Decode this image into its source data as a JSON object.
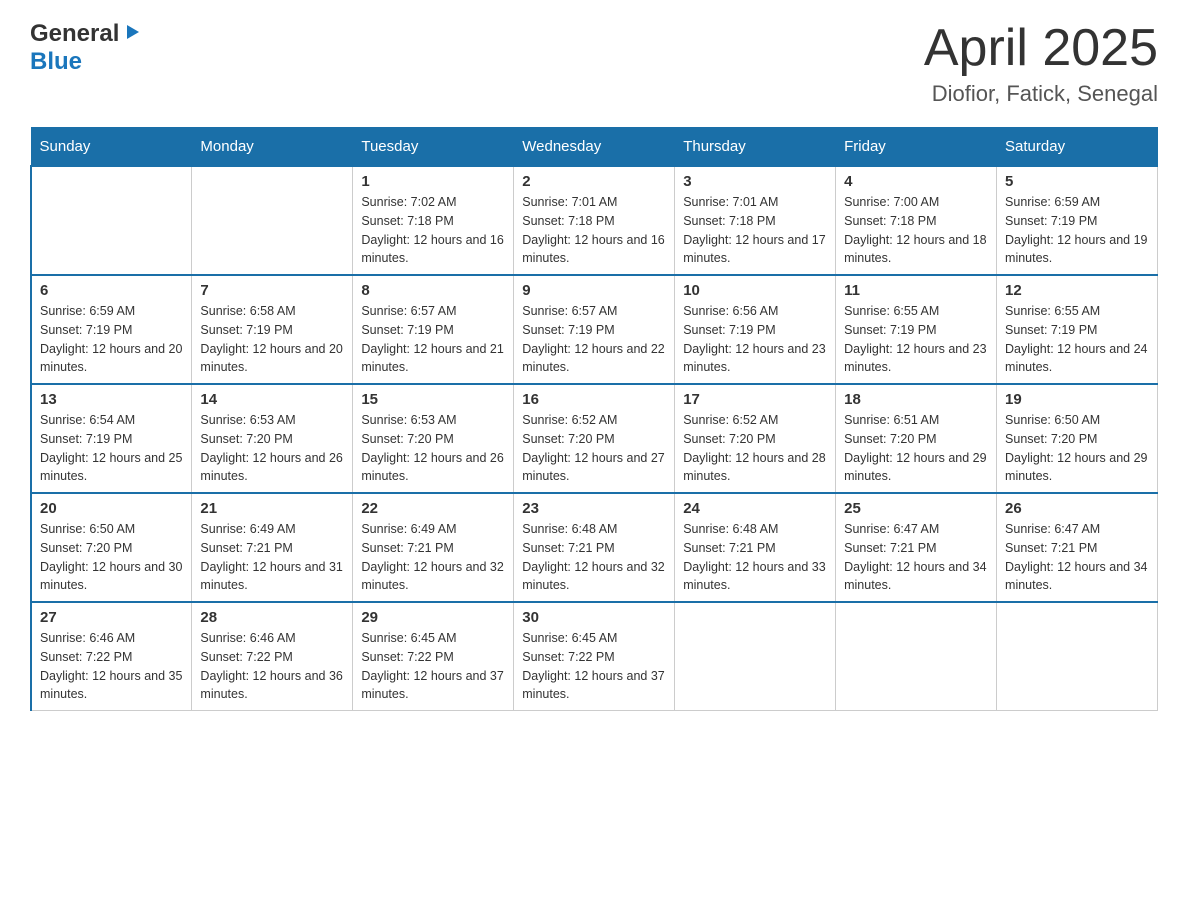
{
  "header": {
    "logo_general": "General",
    "logo_blue": "Blue",
    "month_title": "April 2025",
    "location": "Diofior, Fatick, Senegal"
  },
  "weekdays": [
    "Sunday",
    "Monday",
    "Tuesday",
    "Wednesday",
    "Thursday",
    "Friday",
    "Saturday"
  ],
  "weeks": [
    [
      {
        "day": "",
        "sunrise": "",
        "sunset": "",
        "daylight": ""
      },
      {
        "day": "",
        "sunrise": "",
        "sunset": "",
        "daylight": ""
      },
      {
        "day": "1",
        "sunrise": "Sunrise: 7:02 AM",
        "sunset": "Sunset: 7:18 PM",
        "daylight": "Daylight: 12 hours and 16 minutes."
      },
      {
        "day": "2",
        "sunrise": "Sunrise: 7:01 AM",
        "sunset": "Sunset: 7:18 PM",
        "daylight": "Daylight: 12 hours and 16 minutes."
      },
      {
        "day": "3",
        "sunrise": "Sunrise: 7:01 AM",
        "sunset": "Sunset: 7:18 PM",
        "daylight": "Daylight: 12 hours and 17 minutes."
      },
      {
        "day": "4",
        "sunrise": "Sunrise: 7:00 AM",
        "sunset": "Sunset: 7:18 PM",
        "daylight": "Daylight: 12 hours and 18 minutes."
      },
      {
        "day": "5",
        "sunrise": "Sunrise: 6:59 AM",
        "sunset": "Sunset: 7:19 PM",
        "daylight": "Daylight: 12 hours and 19 minutes."
      }
    ],
    [
      {
        "day": "6",
        "sunrise": "Sunrise: 6:59 AM",
        "sunset": "Sunset: 7:19 PM",
        "daylight": "Daylight: 12 hours and 20 minutes."
      },
      {
        "day": "7",
        "sunrise": "Sunrise: 6:58 AM",
        "sunset": "Sunset: 7:19 PM",
        "daylight": "Daylight: 12 hours and 20 minutes."
      },
      {
        "day": "8",
        "sunrise": "Sunrise: 6:57 AM",
        "sunset": "Sunset: 7:19 PM",
        "daylight": "Daylight: 12 hours and 21 minutes."
      },
      {
        "day": "9",
        "sunrise": "Sunrise: 6:57 AM",
        "sunset": "Sunset: 7:19 PM",
        "daylight": "Daylight: 12 hours and 22 minutes."
      },
      {
        "day": "10",
        "sunrise": "Sunrise: 6:56 AM",
        "sunset": "Sunset: 7:19 PM",
        "daylight": "Daylight: 12 hours and 23 minutes."
      },
      {
        "day": "11",
        "sunrise": "Sunrise: 6:55 AM",
        "sunset": "Sunset: 7:19 PM",
        "daylight": "Daylight: 12 hours and 23 minutes."
      },
      {
        "day": "12",
        "sunrise": "Sunrise: 6:55 AM",
        "sunset": "Sunset: 7:19 PM",
        "daylight": "Daylight: 12 hours and 24 minutes."
      }
    ],
    [
      {
        "day": "13",
        "sunrise": "Sunrise: 6:54 AM",
        "sunset": "Sunset: 7:19 PM",
        "daylight": "Daylight: 12 hours and 25 minutes."
      },
      {
        "day": "14",
        "sunrise": "Sunrise: 6:53 AM",
        "sunset": "Sunset: 7:20 PM",
        "daylight": "Daylight: 12 hours and 26 minutes."
      },
      {
        "day": "15",
        "sunrise": "Sunrise: 6:53 AM",
        "sunset": "Sunset: 7:20 PM",
        "daylight": "Daylight: 12 hours and 26 minutes."
      },
      {
        "day": "16",
        "sunrise": "Sunrise: 6:52 AM",
        "sunset": "Sunset: 7:20 PM",
        "daylight": "Daylight: 12 hours and 27 minutes."
      },
      {
        "day": "17",
        "sunrise": "Sunrise: 6:52 AM",
        "sunset": "Sunset: 7:20 PM",
        "daylight": "Daylight: 12 hours and 28 minutes."
      },
      {
        "day": "18",
        "sunrise": "Sunrise: 6:51 AM",
        "sunset": "Sunset: 7:20 PM",
        "daylight": "Daylight: 12 hours and 29 minutes."
      },
      {
        "day": "19",
        "sunrise": "Sunrise: 6:50 AM",
        "sunset": "Sunset: 7:20 PM",
        "daylight": "Daylight: 12 hours and 29 minutes."
      }
    ],
    [
      {
        "day": "20",
        "sunrise": "Sunrise: 6:50 AM",
        "sunset": "Sunset: 7:20 PM",
        "daylight": "Daylight: 12 hours and 30 minutes."
      },
      {
        "day": "21",
        "sunrise": "Sunrise: 6:49 AM",
        "sunset": "Sunset: 7:21 PM",
        "daylight": "Daylight: 12 hours and 31 minutes."
      },
      {
        "day": "22",
        "sunrise": "Sunrise: 6:49 AM",
        "sunset": "Sunset: 7:21 PM",
        "daylight": "Daylight: 12 hours and 32 minutes."
      },
      {
        "day": "23",
        "sunrise": "Sunrise: 6:48 AM",
        "sunset": "Sunset: 7:21 PM",
        "daylight": "Daylight: 12 hours and 32 minutes."
      },
      {
        "day": "24",
        "sunrise": "Sunrise: 6:48 AM",
        "sunset": "Sunset: 7:21 PM",
        "daylight": "Daylight: 12 hours and 33 minutes."
      },
      {
        "day": "25",
        "sunrise": "Sunrise: 6:47 AM",
        "sunset": "Sunset: 7:21 PM",
        "daylight": "Daylight: 12 hours and 34 minutes."
      },
      {
        "day": "26",
        "sunrise": "Sunrise: 6:47 AM",
        "sunset": "Sunset: 7:21 PM",
        "daylight": "Daylight: 12 hours and 34 minutes."
      }
    ],
    [
      {
        "day": "27",
        "sunrise": "Sunrise: 6:46 AM",
        "sunset": "Sunset: 7:22 PM",
        "daylight": "Daylight: 12 hours and 35 minutes."
      },
      {
        "day": "28",
        "sunrise": "Sunrise: 6:46 AM",
        "sunset": "Sunset: 7:22 PM",
        "daylight": "Daylight: 12 hours and 36 minutes."
      },
      {
        "day": "29",
        "sunrise": "Sunrise: 6:45 AM",
        "sunset": "Sunset: 7:22 PM",
        "daylight": "Daylight: 12 hours and 37 minutes."
      },
      {
        "day": "30",
        "sunrise": "Sunrise: 6:45 AM",
        "sunset": "Sunset: 7:22 PM",
        "daylight": "Daylight: 12 hours and 37 minutes."
      },
      {
        "day": "",
        "sunrise": "",
        "sunset": "",
        "daylight": ""
      },
      {
        "day": "",
        "sunrise": "",
        "sunset": "",
        "daylight": ""
      },
      {
        "day": "",
        "sunrise": "",
        "sunset": "",
        "daylight": ""
      }
    ]
  ]
}
